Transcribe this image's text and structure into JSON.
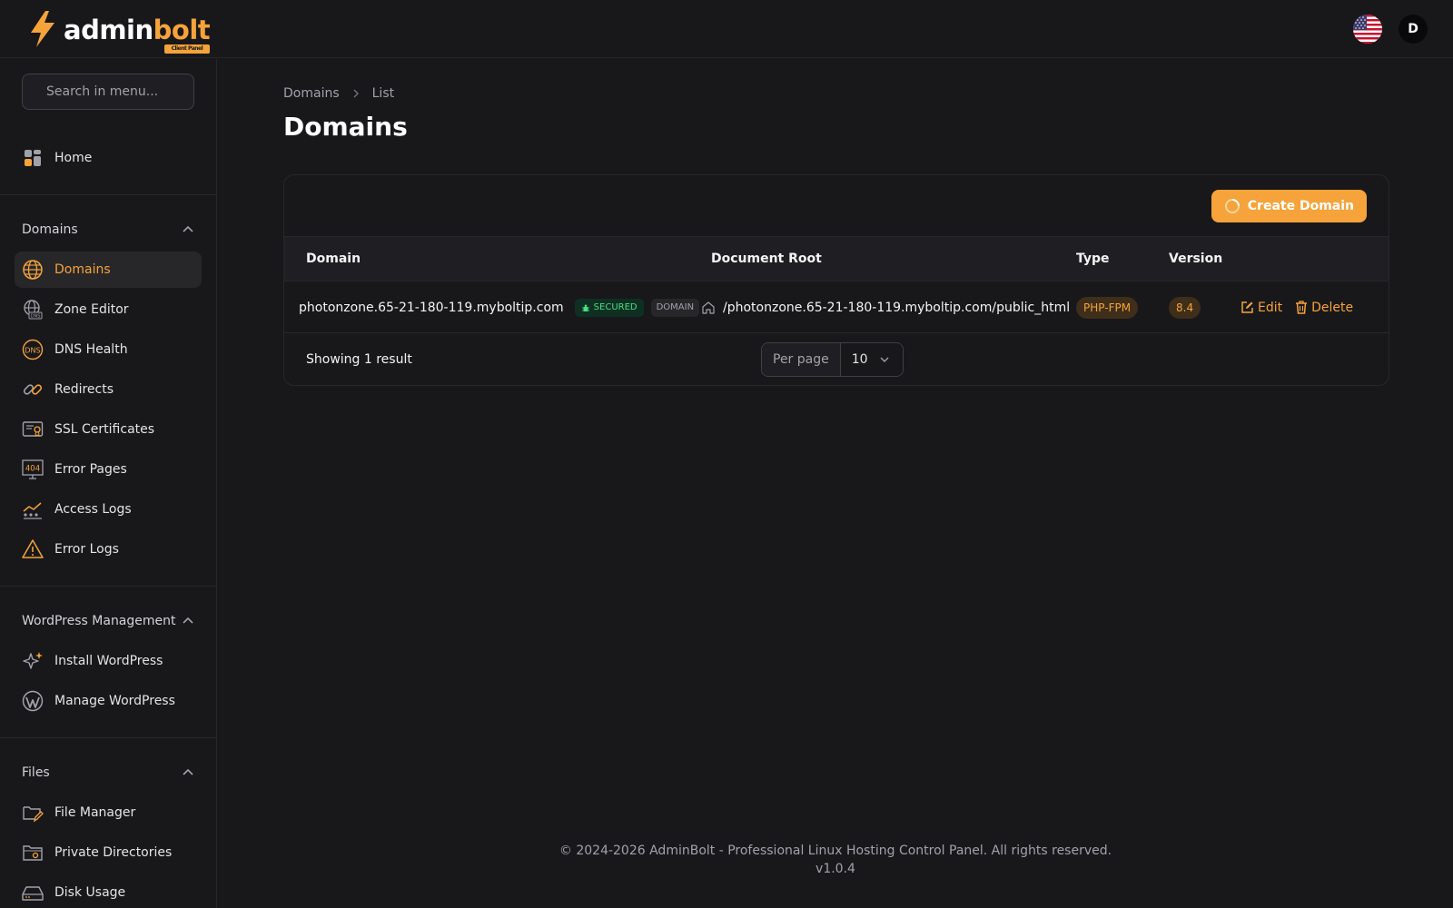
{
  "brand": {
    "name_part1": "admin",
    "name_part2": "bolt",
    "badge": "Client Panel",
    "accent": "#f5a33a"
  },
  "header": {
    "avatar_initial": "D",
    "flag_icon": "us-flag-icon"
  },
  "sidebar": {
    "search_placeholder": "Search in menu...",
    "home": "Home",
    "groups": [
      {
        "title": "Domains",
        "items": [
          "Domains",
          "Zone Editor",
          "DNS Health",
          "Redirects",
          "SSL Certificates",
          "Error Pages",
          "Access Logs",
          "Error Logs"
        ]
      },
      {
        "title": "WordPress Management",
        "items": [
          "Install WordPress",
          "Manage WordPress"
        ]
      },
      {
        "title": "Files",
        "items": [
          "File Manager",
          "Private Directories",
          "Disk Usage"
        ]
      }
    ],
    "active_item": "Domains"
  },
  "breadcrumb": {
    "parent": "Domains",
    "current": "List"
  },
  "page": {
    "title": "Domains"
  },
  "toolbar": {
    "create_label": "Create Domain"
  },
  "table": {
    "headers": {
      "domain": "Domain",
      "document_root": "Document Root",
      "type": "Type",
      "version": "Version"
    },
    "rows": [
      {
        "domain": "photonzone.65-21-180-119.myboltip.com",
        "secured_badge": "SECURED",
        "type_badge": "DOMAIN",
        "document_root": "/photonzone.65-21-180-119.myboltip.com/public_html",
        "type": "PHP-FPM",
        "version": "8.4",
        "edit_label": "Edit",
        "delete_label": "Delete"
      }
    ]
  },
  "pagination": {
    "showing": "Showing 1 result",
    "per_page_label": "Per page",
    "per_page_value": "10"
  },
  "footer": {
    "copyright": "© 2024-2026 AdminBolt - Professional Linux Hosting Control Panel. All rights reserved.",
    "version": "v1.0.4"
  }
}
